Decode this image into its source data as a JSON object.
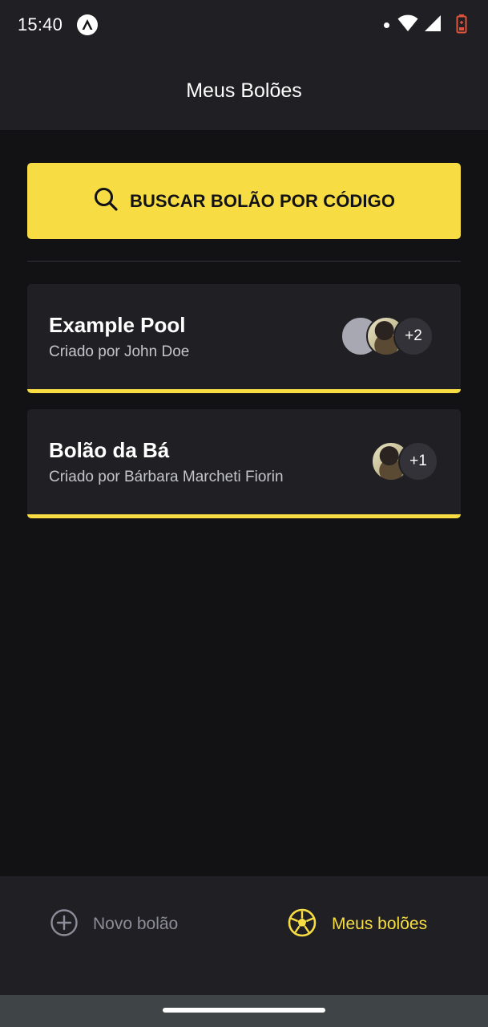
{
  "status_bar": {
    "time": "15:40"
  },
  "header": {
    "title": "Meus Bolões"
  },
  "search": {
    "button_label": "BUSCAR BOLÃO POR CÓDIGO"
  },
  "pools": [
    {
      "title": "Example Pool",
      "owner": "Criado por John Doe",
      "extra_participants": "+2"
    },
    {
      "title": "Bolão da Bá",
      "owner": "Criado por Bárbara Marcheti Fiorin",
      "extra_participants": "+1"
    }
  ],
  "tabs": [
    {
      "label": "Novo bolão",
      "icon": "plus-circle-icon",
      "active": false
    },
    {
      "label": "Meus bolões",
      "icon": "soccer-ball-icon",
      "active": true
    }
  ],
  "colors": {
    "accent": "#F7DD43",
    "background": "#121214",
    "surface": "#202024",
    "muted_text": "#C4C4CC",
    "inactive_tab": "#8D8D99"
  }
}
